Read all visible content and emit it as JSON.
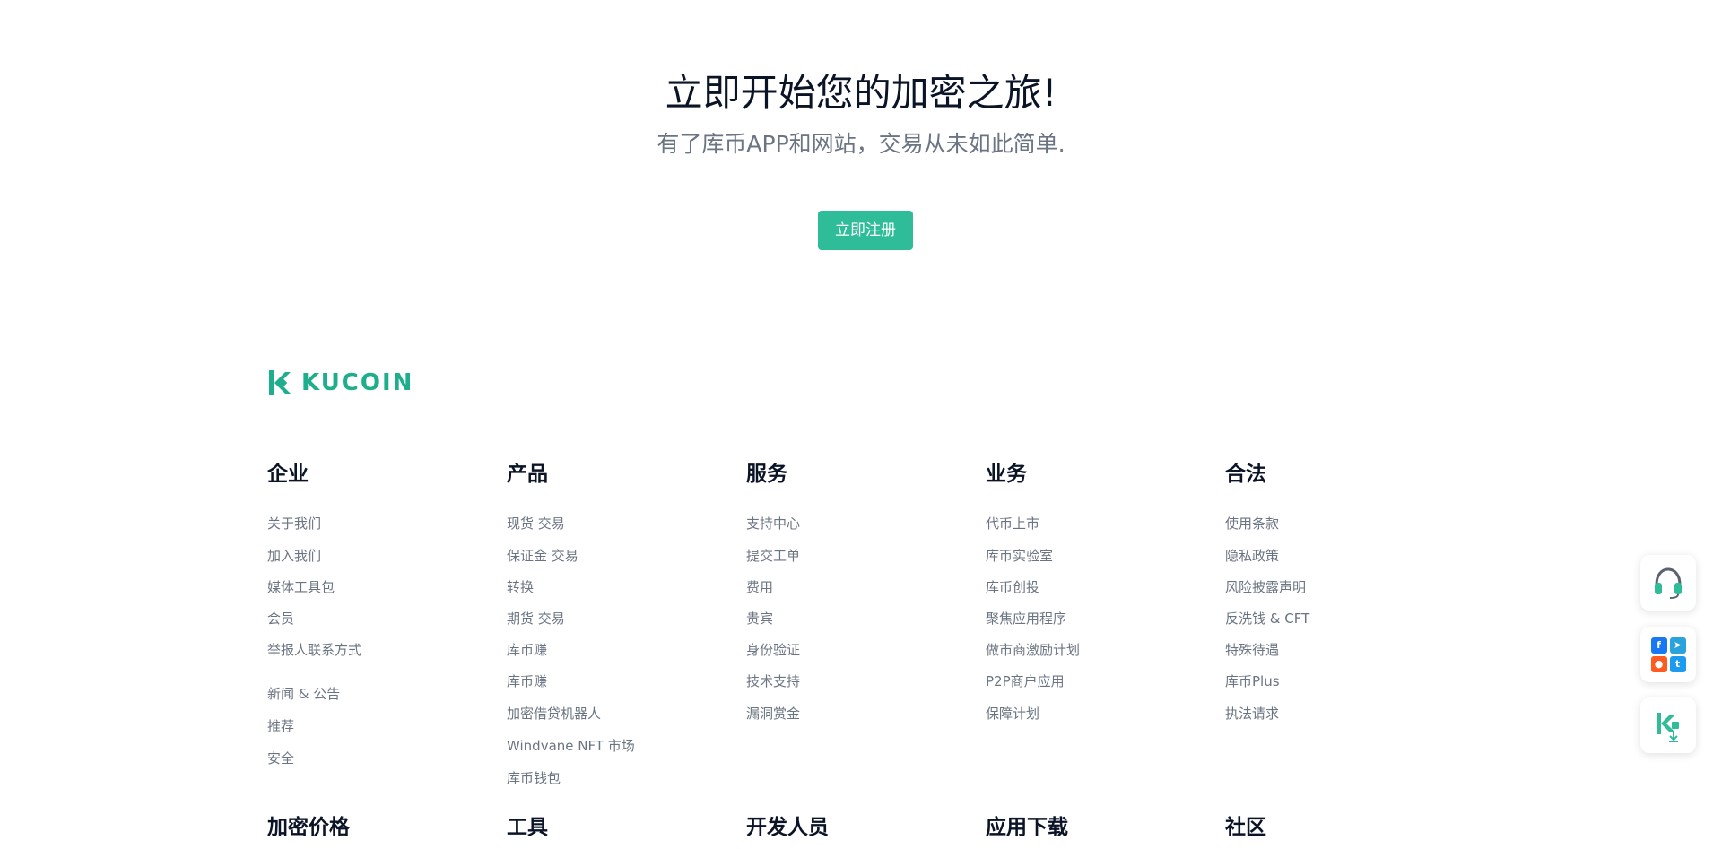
{
  "hero": {
    "title": "立即开始您的加密之旅!",
    "subtitle": "有了库币APP和网站，交易从未如此简单.",
    "cta_label": "立即注册"
  },
  "brand": {
    "name": "KUCOIN",
    "accent_color": "#2ebd98"
  },
  "footer": {
    "columns": [
      {
        "title": "企业",
        "links": [
          "关于我们",
          "加入我们",
          "媒体工具包",
          "会员",
          "举报人联系方式",
          "新闻 & 公告",
          "推荐",
          "安全"
        ]
      },
      {
        "title": "产品",
        "links": [
          "现货 交易",
          "保证金 交易",
          "转换",
          "期货 交易",
          "库币赚",
          "库币赚",
          "加密借贷机器人",
          "Windvane NFT 市场",
          "库币钱包"
        ]
      },
      {
        "title": "服务",
        "links": [
          "支持中心",
          "提交工单",
          "费用",
          "贵宾",
          "身份验证",
          "技术支持",
          "漏洞赏金"
        ]
      },
      {
        "title": "业务",
        "links": [
          "代币上市",
          "库币实验室",
          "库币创投",
          "聚焦应用程序",
          "做市商激励计划",
          "P2P商户应用",
          "保障计划"
        ]
      },
      {
        "title": "合法",
        "links": [
          "使用条款",
          "隐私政策",
          "风险披露声明",
          "反洗钱 & CFT",
          "特殊待遇",
          "库币Plus",
          "执法请求"
        ]
      }
    ],
    "next_row_titles": [
      "加密价格",
      "工具",
      "开发人员",
      "应用下载",
      "社区"
    ]
  },
  "floating": {
    "support_icon": "headset-icon",
    "social_icons": [
      "facebook-icon",
      "telegram-icon",
      "reddit-icon",
      "twitter-icon"
    ],
    "download_icon": "app-download-icon"
  }
}
